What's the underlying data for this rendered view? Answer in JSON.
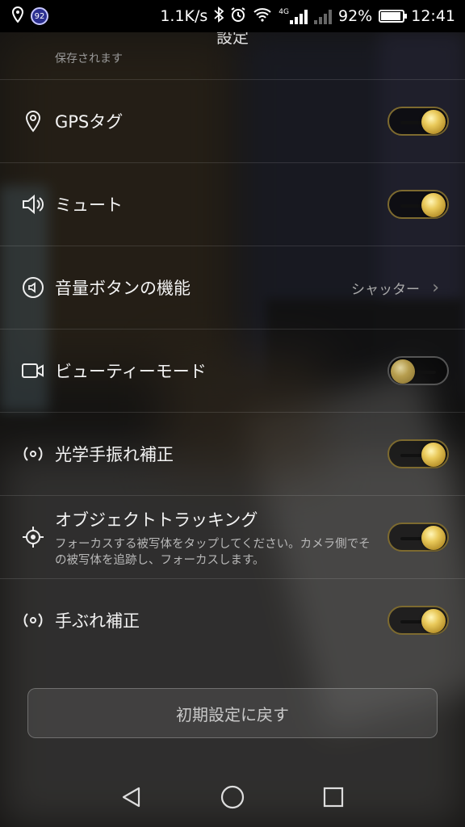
{
  "status_bar": {
    "badge": "92",
    "speed": "1.1K/s",
    "network": "4G",
    "battery": "92%",
    "battery_level": 0.92,
    "time": "12:41"
  },
  "header": {
    "title": "設定",
    "subtitle": "保存されます"
  },
  "settings": [
    {
      "icon": "location-pin-icon",
      "label": "GPSタグ",
      "toggle": "on"
    },
    {
      "icon": "speaker-icon",
      "label": "ミュート",
      "toggle": "on"
    },
    {
      "icon": "volume-button-icon",
      "label": "音量ボタンの機能",
      "value": "シャッター"
    },
    {
      "icon": "video-camera-icon",
      "label": "ビューティーモード",
      "toggle": "off"
    },
    {
      "icon": "stabilization-icon",
      "label": "光学手振れ補正",
      "toggle": "on"
    },
    {
      "icon": "crosshair-icon",
      "label": "オブジェクトトラッキング",
      "description": "フォーカスする被写体をタップしてください。カメラ側でその被写体を追跡し、フォーカスします。",
      "toggle": "on"
    },
    {
      "icon": "stabilization-icon",
      "label": "手ぶれ補正",
      "toggle": "on"
    }
  ],
  "reset_button": "初期設定に戻す",
  "colors": {
    "accent_gold": "#e9c95a",
    "toggle_border_on": "#7d6a2f"
  }
}
